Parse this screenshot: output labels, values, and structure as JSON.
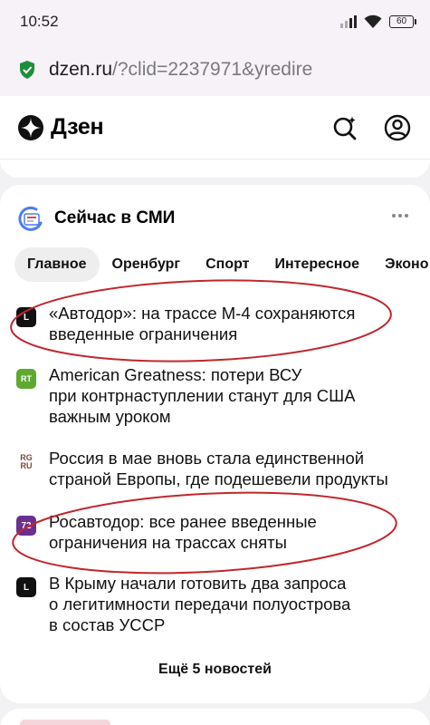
{
  "status_bar": {
    "time": "10:52",
    "battery": "60",
    "icons": [
      "signal-icon",
      "wifi-icon",
      "battery-icon"
    ]
  },
  "browser": {
    "url_host": "dzen.ru",
    "url_rest": "/?clid=2237971&yredire",
    "secure_icon": "shield-check-icon"
  },
  "app": {
    "logo_text": "Дзен",
    "actions": [
      "search-ai-icon",
      "profile-icon"
    ]
  },
  "news_block": {
    "title": "Сейчас в СМИ",
    "tabs": [
      {
        "label": "Главное",
        "active": true
      },
      {
        "label": "Оренбург",
        "active": false
      },
      {
        "label": "Спорт",
        "active": false
      },
      {
        "label": "Интересное",
        "active": false
      },
      {
        "label": "Эконо",
        "active": false
      }
    ],
    "items": [
      {
        "source": "L",
        "lines": [
          "«Автодор»: на трассе М-4 сохраняются",
          "введенные ограничения"
        ],
        "circled": true
      },
      {
        "source": "RT",
        "lines": [
          "American Greatness: потери ВСУ",
          "при контрнаступлении станут для США",
          "важным уроком"
        ],
        "circled": false
      },
      {
        "source": "RG RU",
        "lines": [
          "Россия в мае вновь стала единственной",
          "страной Европы, где подешевели продукты"
        ],
        "circled": false
      },
      {
        "source": "72",
        "lines": [
          "Росавтодор: все ранее введенные",
          "ограничения на трассах сняты"
        ],
        "circled": true
      },
      {
        "source": "L",
        "lines": [
          "В Крыму начали готовить два запроса",
          "о легитимности передачи полуострова",
          "в состав УССР"
        ],
        "circled": false
      }
    ],
    "more_label": "Ещё 5 новостей"
  },
  "colors": {
    "annotation": "#c0272d",
    "rt_green": "#5fa832",
    "src_72": "#6a2f8f",
    "accent_blue": "#4d7cf0",
    "secure_green": "#1e8e3e"
  }
}
